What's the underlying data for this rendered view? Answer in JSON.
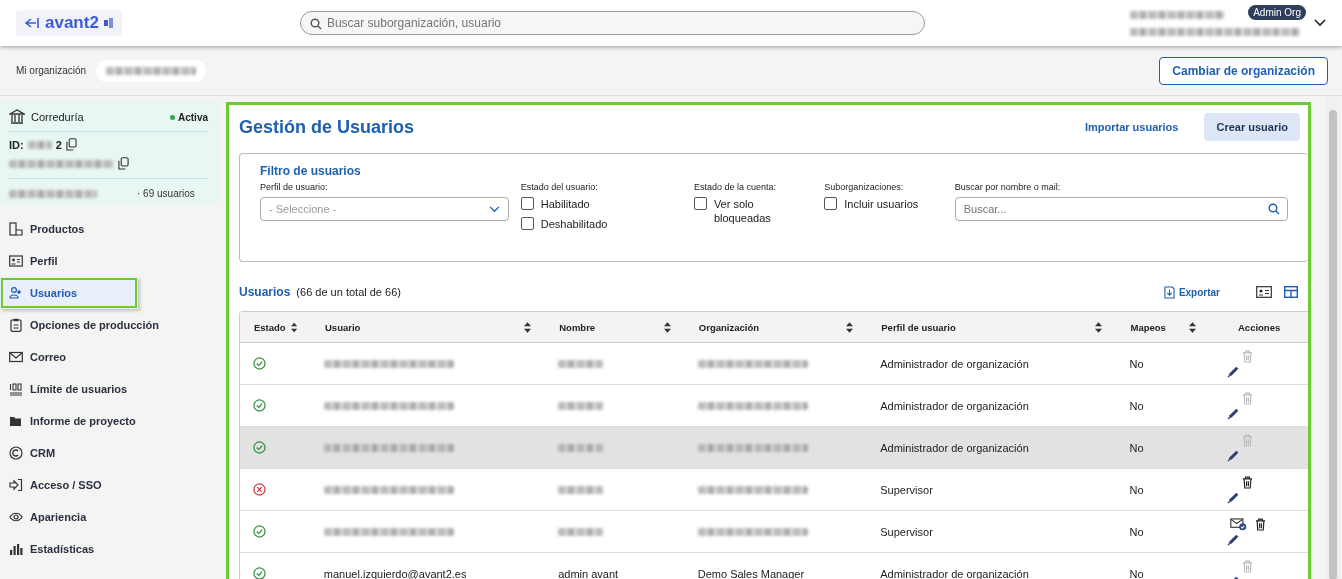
{
  "header": {
    "logo": "avant2",
    "search": {
      "placeholder": "Buscar suborganización, usuario"
    },
    "role_badge": "Admin Org"
  },
  "org_bar": {
    "label": "Mi organización",
    "button": "Cambiar de organización"
  },
  "org_card": {
    "type": "Correduría",
    "status": "Activa",
    "id_label": "ID:",
    "id_suffix": "2",
    "users": "· 69 usuarios"
  },
  "sidebar": {
    "items": [
      {
        "label": "Productos",
        "selected": false
      },
      {
        "label": "Perfil",
        "selected": false
      },
      {
        "label": "Usuarios",
        "selected": true
      },
      {
        "label": "Opciones de producción",
        "selected": false
      },
      {
        "label": "Correo",
        "selected": false
      },
      {
        "label": "Límite de usuarios",
        "selected": false
      },
      {
        "label": "Informe de proyecto",
        "selected": false
      },
      {
        "label": "CRM",
        "selected": false
      },
      {
        "label": "Acceso / SSO",
        "selected": false
      },
      {
        "label": "Apariencia",
        "selected": false
      },
      {
        "label": "Estadísticas",
        "selected": false
      }
    ]
  },
  "page": {
    "title": "Gestión de Usuarios",
    "import_link": "Importar usuarios",
    "create_button": "Crear usuario"
  },
  "filter": {
    "title": "Filtro de usuarios",
    "profile": {
      "label": "Perfil de usuario:",
      "placeholder": "- Seleccione -"
    },
    "user_state": {
      "label": "Estado del usuario:",
      "options": [
        {
          "label": "Habilitado",
          "checked": false
        },
        {
          "label": "Deshabilitado",
          "checked": false
        }
      ]
    },
    "account_state": {
      "label": "Estado de la cuenta:",
      "options": [
        {
          "label": "Ver solo bloqueadas",
          "checked": false
        }
      ]
    },
    "suborgs": {
      "label": "Suborganizaciones:",
      "options": [
        {
          "label": "Incluir usuarios",
          "checked": false
        }
      ]
    },
    "search": {
      "label": "Buscar por nombre o mail:",
      "placeholder": "Buscar..."
    }
  },
  "table": {
    "title": "Usuarios",
    "count": "(66 de un total de 66)",
    "export": "Exportar",
    "columns": [
      {
        "label": "Estado",
        "sortable": true
      },
      {
        "label": "Usuario",
        "sortable": true
      },
      {
        "label": "Nombre",
        "sortable": true
      },
      {
        "label": "Organización",
        "sortable": true
      },
      {
        "label": "Perfil de usuario",
        "sortable": true
      },
      {
        "label": "Mapeos",
        "sortable": true
      },
      {
        "label": "Acciones",
        "sortable": false
      }
    ],
    "rows": [
      {
        "enabled": true,
        "profile": "Administrador de organización",
        "mappings": "No",
        "deletable": false,
        "mail_action": false,
        "highlighted": false
      },
      {
        "enabled": true,
        "profile": "Administrador de organización",
        "mappings": "No",
        "deletable": false,
        "mail_action": false,
        "highlighted": false
      },
      {
        "enabled": true,
        "profile": "Administrador de organización",
        "mappings": "No",
        "deletable": false,
        "mail_action": false,
        "highlighted": true
      },
      {
        "enabled": false,
        "profile": "Supervisor",
        "mappings": "No",
        "deletable": true,
        "mail_action": false,
        "highlighted": false
      },
      {
        "enabled": true,
        "profile": "Supervisor",
        "mappings": "No",
        "deletable": true,
        "mail_action": true,
        "highlighted": false
      },
      {
        "enabled": true,
        "user": "manuel.izquierdo@avant2.es",
        "name": "admin avant",
        "org": "Demo Sales Manager",
        "profile": "Administrador de organización",
        "mappings": "No",
        "deletable": false,
        "mail_action": false,
        "highlighted": false
      }
    ]
  }
}
